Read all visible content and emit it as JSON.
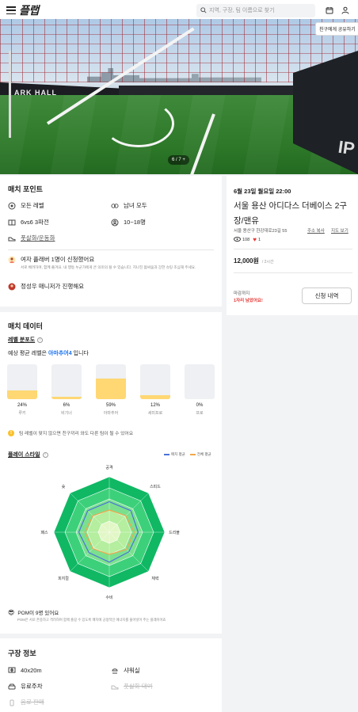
{
  "header": {
    "logo": "플랩",
    "search_placeholder": "지역, 구장, 팀 이름으로 찾기"
  },
  "photo": {
    "pager": "6 / 7  +",
    "wall_left_text": "ARK HALL",
    "wall_right_text": "IP",
    "share_tip": "친구에게 공유하기"
  },
  "match_point": {
    "title": "매치 포인트",
    "items": [
      "모든 레벨",
      "남녀 모두",
      "6vs6 3파전",
      "10~18명",
      "풋살화/운동화"
    ],
    "notice1": "여자 플래버 1명이 신청했어요",
    "notice1_sub": "서로 배려하며, 함께 즐겨요. 내 행동 누군가에게 큰 의미의 될 수 있습니다. 지나친 몸싸움과 강한 슈팅 조심해 주세요.",
    "notice2": "정성우 매니저가 진행해요"
  },
  "match_info": {
    "date": "6월 23일 월요일 22:00",
    "title": "서울 용산 아디다스 더베이스 2구장/맨유",
    "address": "서울 용산구 한강대로23길 55",
    "copy_address": "주소 복사",
    "view_map": "지도 보기",
    "views": "108",
    "likes": "1",
    "price": "12,000원",
    "price_unit": "/ 2시간",
    "deadline_label": "마감까지",
    "deadline_value": "1자리 남았어요!",
    "apply_button": "신청 내역"
  },
  "match_data": {
    "title": "매치 데이터",
    "level_title": "레벨 분포도",
    "level_summary_prefix": "예상 평균 레벨은",
    "level_summary_value": "아마추어4",
    "level_summary_suffix": "입니다",
    "tip": "팀 레벨이 맞지 않으면 친구끼리 와도 다른 팀이 될 수 있어요",
    "style_title": "플레이 스타일",
    "legend_match": "매치 평균",
    "legend_all": "전체 평균",
    "pom": "POM이 9명 있어요",
    "pom_sub": "POM은 서로 존중하고 격려하며 함께 즐길 수 있도록 매치에 긍정적인 에너지를 불어넣어 주는 플레이어죠"
  },
  "chart_data": [
    {
      "type": "bar",
      "title": "레벨 분포도",
      "categories": [
        "루키",
        "비기너",
        "아마추어",
        "세미프로",
        "프로"
      ],
      "values": [
        24,
        6,
        59,
        12,
        0
      ],
      "value_labels": [
        "24%",
        "6%",
        "59%",
        "12%",
        "0%"
      ],
      "colors": {
        "fill": "#ffd773",
        "track": "#eef0f3"
      }
    },
    {
      "type": "radar",
      "title": "플레이 스타일",
      "axes": [
        "공격",
        "스피드",
        "드리블",
        "체력",
        "수비",
        "피지컬",
        "패스",
        "슛"
      ],
      "series": [
        {
          "name": "매치 평균",
          "values": [
            55,
            55,
            52,
            50,
            54,
            52,
            55,
            55
          ],
          "color": "#4a73d8"
        },
        {
          "name": "전체 평균",
          "values": [
            40,
            42,
            45,
            44,
            40,
            42,
            44,
            42
          ],
          "color": "#f0a84b"
        }
      ],
      "band_colors": [
        "#10b864",
        "#3dd07a",
        "#7be08e",
        "#b4ee9e",
        "#e2f7c6"
      ],
      "range": [
        0,
        100
      ]
    }
  ],
  "stadium": {
    "title": "구장 정보",
    "size": "40x20m",
    "shower": "샤워실",
    "parking": "유료주차",
    "shoes": "풋살화 대여",
    "drinks": "음료 판매"
  }
}
